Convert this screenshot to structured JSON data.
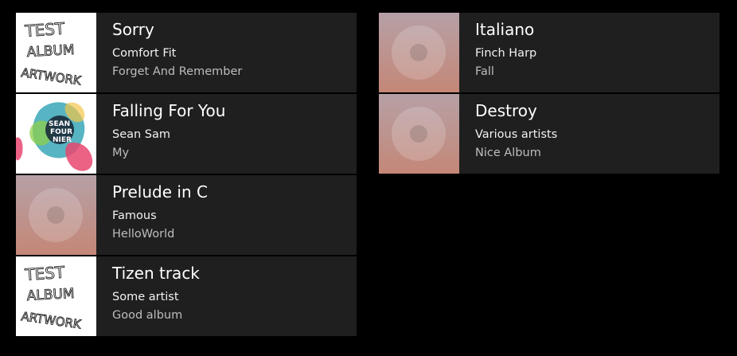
{
  "tracks_left": [
    {
      "title": "Sorry",
      "artist": "Comfort Fit",
      "album": "Forget And Remember",
      "artwork": "test-album-artwork",
      "artwork_text": [
        "TEST",
        "ALBUM",
        "ARTWORK"
      ]
    },
    {
      "title": "Falling For You",
      "artist": "Sean Sam",
      "album": "My",
      "artwork": "sean-fournier-album-artwork",
      "artwork_text": [
        "SEAN",
        "FOUR",
        "NIER"
      ]
    },
    {
      "title": "Prelude in C",
      "artist": "Famous",
      "album": "HelloWorld",
      "artwork": "default-disc-artwork"
    },
    {
      "title": "Tizen track",
      "artist": "Some artist",
      "album": "Good album",
      "artwork": "test-album-artwork",
      "artwork_text": [
        "TEST",
        "ALBUM",
        "ARTWORK"
      ]
    }
  ],
  "tracks_right": [
    {
      "title": "Italiano",
      "artist": "Finch Harp",
      "album": "Fall",
      "artwork": "default-disc-artwork"
    },
    {
      "title": "Destroy",
      "artist": "Various artists",
      "album": "Nice Album",
      "artwork": "default-disc-artwork"
    }
  ],
  "colors": {
    "background": "#000000",
    "row_background": "#1f1f1f",
    "title_text": "#ffffff",
    "artist_text": "#f2f2f2",
    "album_text": "#bdbdbd",
    "disc_gradient_top": "#b6a0a6",
    "disc_gradient_bottom": "#c48777"
  }
}
